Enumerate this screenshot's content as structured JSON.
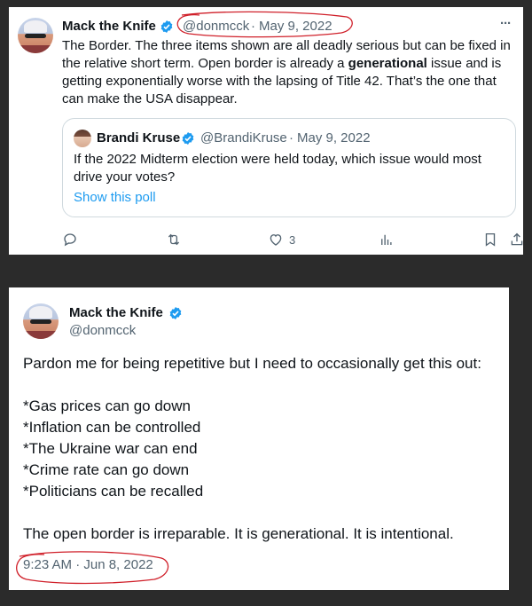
{
  "tweet1": {
    "author_name": "Mack the Knife",
    "handle": "@donmcck",
    "separator": "·",
    "date": "May 9, 2022",
    "more_label": "···",
    "text_part1": "The Border. The three items shown are all deadly serious but can be fixed in the relative short term. Open border is already a ",
    "text_bold": "generational",
    "text_part2": " issue and is getting exponentially worse with the lapsing of Title 42. That’s the one that can make the USA disappear.",
    "quote": {
      "author_name": "Brandi Kruse",
      "handle": "@BrandiKruse",
      "separator": "·",
      "date": "May 9, 2022",
      "text": "If the 2022 Midterm election were held today, which issue would most drive your votes?",
      "poll_link": "Show this poll"
    },
    "actions": {
      "like_count": "3"
    }
  },
  "tweet2": {
    "author_name": "Mack the Knife",
    "handle": "@donmcck",
    "intro": "Pardon me for being repetitive but I need to occasionally get this out:",
    "items": [
      "*Gas prices can go down",
      "*Inflation can be controlled",
      "*The Ukraine war can end",
      "*Crime rate can go down",
      "*Politicians can be recalled"
    ],
    "closing": "The open border is irreparable. It is generational. It is intentional.",
    "timestamp": "9:23 AM · Jun 8, 2022"
  },
  "colors": {
    "text": "#0f1419",
    "muted": "#536471",
    "link": "#1d9bf0",
    "verified": "#1d9bf0",
    "annotation": "#d0202a",
    "background": "#2b2b2b"
  },
  "icons": [
    "verified-badge-icon",
    "more-icon",
    "reply-icon",
    "retweet-icon",
    "like-icon",
    "views-icon",
    "bookmark-icon",
    "share-icon"
  ]
}
